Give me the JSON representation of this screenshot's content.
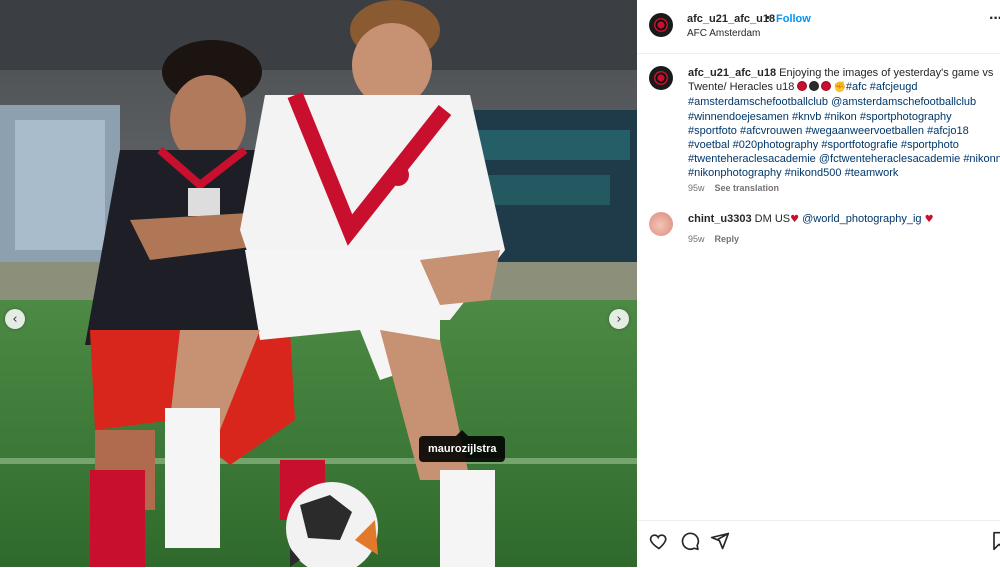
{
  "photo": {
    "tag_label": "maurozijlstra",
    "prev_icon": "chevron-left-icon",
    "next_icon": "chevron-right-icon",
    "prev_glyph": "‹",
    "next_glyph": "›"
  },
  "header": {
    "username": "afc_u21_afc_u18",
    "separator": "•",
    "follow_label": "Follow",
    "location": "AFC Amsterdam",
    "more_glyph": "···"
  },
  "caption": {
    "username": "afc_u21_afc_u18",
    "text_line1": "Enjoying the images of yesterday's game vs",
    "text_line2": "Twente/ Heracles u18",
    "line2_tags": "#afc #afcjeugd",
    "lines": [
      "#amsterdamschefootballclub @amsterdamschefootballclub",
      "#winnendoejesamen #knvb #nikon #sportphotography",
      "#sportfoto #afcvrouwen #wegaanweervoetballen #afcjo18",
      "#voetbal #020photography #sportfotografie #sportphoto",
      "#twenteheraclesacademie @fctwenteheraclesacademie #nikonnl",
      "#nikonphotography #nikond500 #teamwork"
    ],
    "time": "95w",
    "see_translation": "See translation"
  },
  "comment": {
    "username": "chint_u3303",
    "text": "DM US",
    "mention": "@world_photography_ig",
    "time": "95w",
    "reply": "Reply"
  },
  "colors": {
    "accent": "#0095f6",
    "link": "#00376b",
    "afc_red": "#c8102e"
  }
}
